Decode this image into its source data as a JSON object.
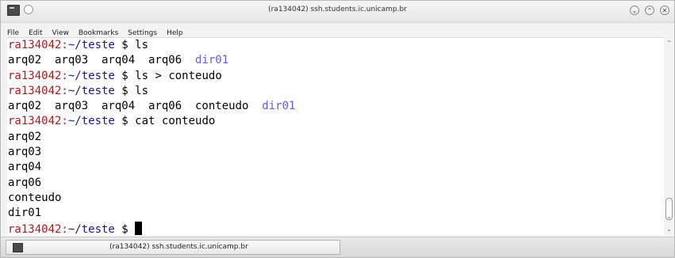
{
  "window": {
    "title": "(ra134042) ssh.students.ic.unicamp.br",
    "buttons": {
      "minimize": "⌄",
      "maximize": "⌃",
      "close": "✕"
    }
  },
  "menu": {
    "items": [
      "File",
      "Edit",
      "View",
      "Bookmarks",
      "Settings",
      "Help"
    ]
  },
  "terminal": {
    "colors": {
      "user": "#b21818",
      "path": "#18178a",
      "directory": "#5c5cff"
    },
    "prompt_user": "ra134042:",
    "prompt_path": "~/teste",
    "prompt_symbol": " $ ",
    "lines": {
      "l0_cmd": "ls",
      "l1_files": "arq02  arq03  arq04  arq06  ",
      "l1_dir": "dir01",
      "l2_cmd": "ls > conteudo",
      "l3_cmd": "ls",
      "l4_files": "arq02  arq03  arq04  arq06  conteudo  ",
      "l4_dir": "dir01",
      "l5_cmd": "cat conteudo",
      "l6": "arq02",
      "l7": "arq03",
      "l8": "arq04",
      "l9": "arq06",
      "l10": "conteudo",
      "l11": "dir01"
    }
  },
  "taskbar": {
    "task_label": "(ra134042) ssh.students.ic.unicamp.br"
  }
}
